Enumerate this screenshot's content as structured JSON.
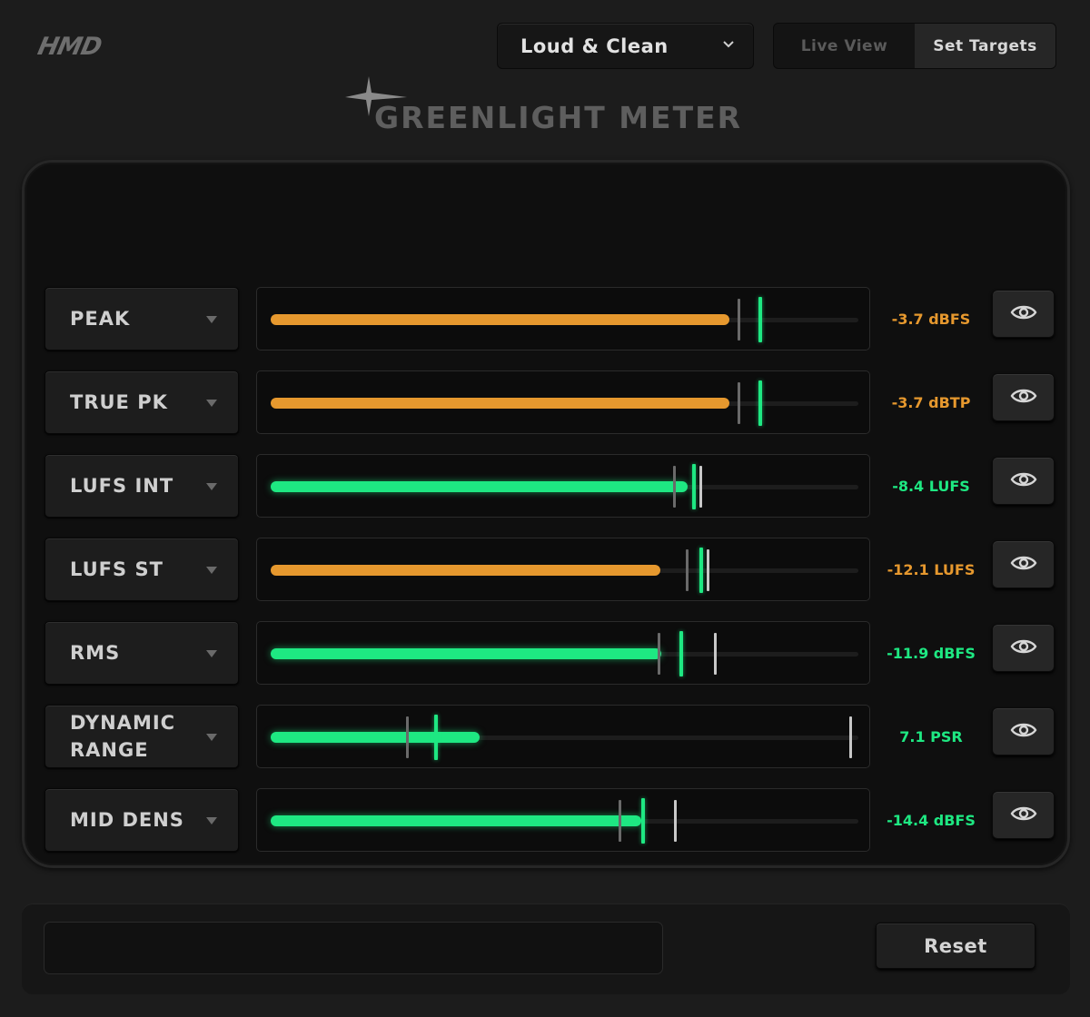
{
  "app": {
    "logo": "HMD",
    "title": "GREENLIGHT METER"
  },
  "header": {
    "preset_value": "Loud & Clean",
    "view_tabs": [
      {
        "label": "Live View",
        "active": false
      },
      {
        "label": "Set Targets",
        "active": true
      }
    ]
  },
  "colors": {
    "accent_green": "#1ee882",
    "accent_orange": "#e6982e",
    "target_gray": "#6a6a6a",
    "target_white": "#c8c8c8"
  },
  "meters": [
    {
      "label": "PEAK",
      "readout": "-3.7 dBFS",
      "status": "orange",
      "fill_fraction": 0.78,
      "markers": [
        {
          "type": "gray",
          "pos": 0.795
        },
        {
          "type": "green",
          "pos": 0.83
        }
      ]
    },
    {
      "label": "TRUE PK",
      "readout": "-3.7 dBTP",
      "status": "orange",
      "fill_fraction": 0.78,
      "markers": [
        {
          "type": "gray",
          "pos": 0.795
        },
        {
          "type": "green",
          "pos": 0.83
        }
      ]
    },
    {
      "label": "LUFS INT",
      "readout": "-8.4 LUFS",
      "status": "green",
      "fill_fraction": 0.71,
      "markers": [
        {
          "type": "gray",
          "pos": 0.685
        },
        {
          "type": "green",
          "pos": 0.717
        },
        {
          "type": "white",
          "pos": 0.73
        }
      ]
    },
    {
      "label": "LUFS ST",
      "readout": "-12.1 LUFS",
      "status": "orange",
      "fill_fraction": 0.663,
      "markers": [
        {
          "type": "gray",
          "pos": 0.706
        },
        {
          "type": "green",
          "pos": 0.73
        },
        {
          "type": "white",
          "pos": 0.742
        }
      ]
    },
    {
      "label": "RMS",
      "readout": "-11.9 dBFS",
      "status": "green",
      "fill_fraction": 0.665,
      "markers": [
        {
          "type": "gray",
          "pos": 0.658
        },
        {
          "type": "green",
          "pos": 0.695
        },
        {
          "type": "white",
          "pos": 0.754
        }
      ]
    },
    {
      "label": "DYNAMIC RANGE",
      "readout": "7.1 PSR",
      "status": "green",
      "fill_fraction": 0.355,
      "markers": [
        {
          "type": "gray",
          "pos": 0.23
        },
        {
          "type": "green",
          "pos": 0.278
        },
        {
          "type": "white",
          "pos": 0.985
        }
      ]
    },
    {
      "label": "MID DENS",
      "readout": "-14.4 dBFS",
      "status": "green",
      "fill_fraction": 0.63,
      "markers": [
        {
          "type": "gray",
          "pos": 0.592
        },
        {
          "type": "green",
          "pos": 0.63
        },
        {
          "type": "white",
          "pos": 0.687
        }
      ]
    }
  ],
  "footer": {
    "message": "",
    "reset_label": "Reset"
  }
}
